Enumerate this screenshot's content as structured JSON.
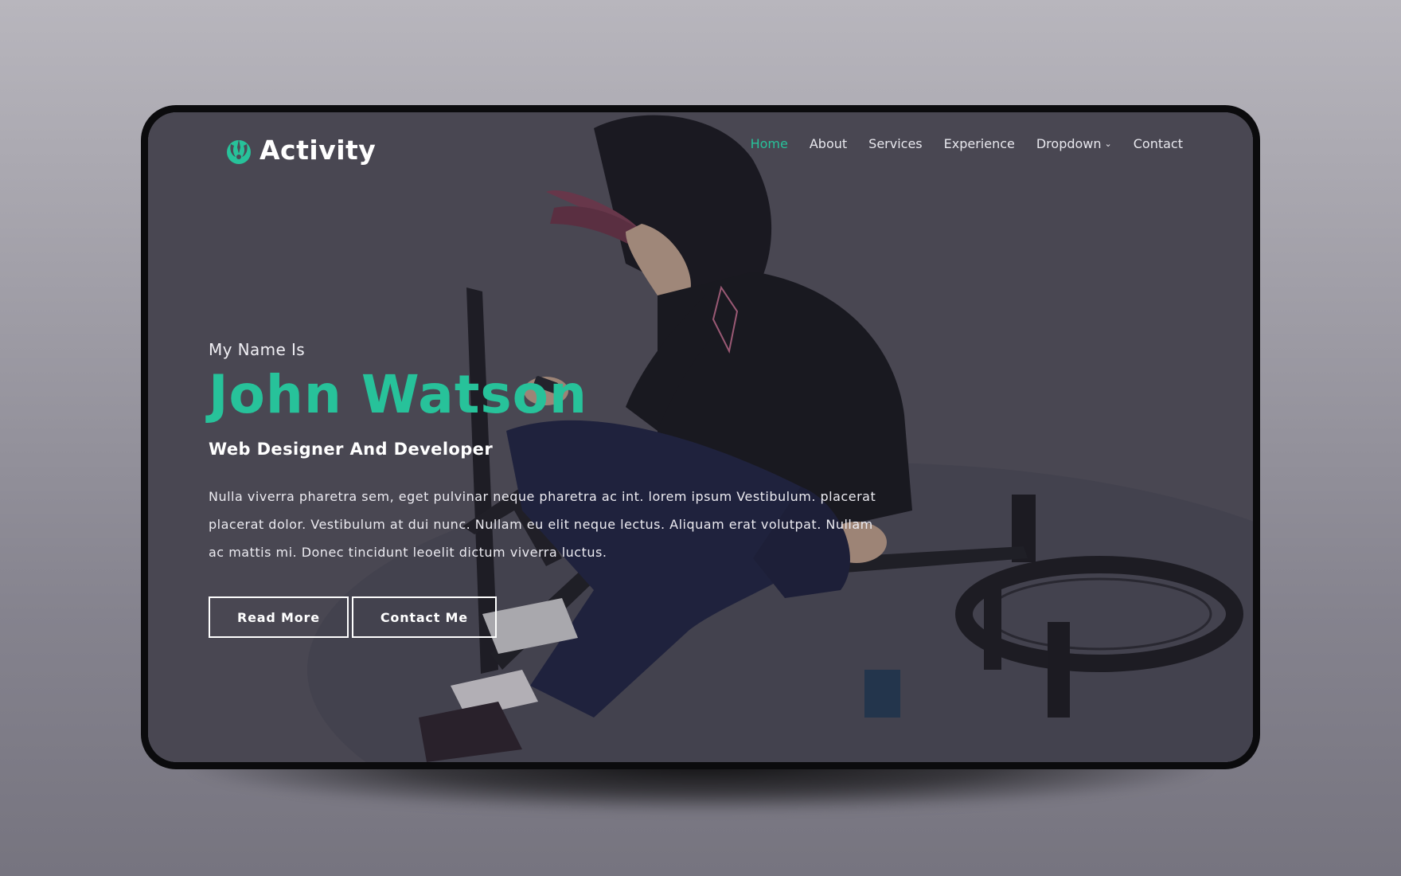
{
  "brand": {
    "name": "Activity",
    "icon": "rebel-emblem-icon",
    "accent_color": "#27c29a"
  },
  "nav": {
    "items": [
      {
        "label": "Home",
        "active": true
      },
      {
        "label": "About",
        "active": false
      },
      {
        "label": "Services",
        "active": false
      },
      {
        "label": "Experience",
        "active": false
      },
      {
        "label": "Dropdown",
        "active": false,
        "has_submenu": true
      },
      {
        "label": "Contact",
        "active": false
      }
    ],
    "chevron_icon": "chevron-down-icon"
  },
  "hero": {
    "intro": "My Name Is",
    "name": "John Watson",
    "role": "Web Designer And Developer",
    "description": "Nulla viverra pharetra sem, eget pulvinar neque pharetra ac int. lorem ipsum Vestibulum. placerat placerat dolor. Vestibulum at dui nunc. Nullam eu elit neque lectus. Aliquam erat volutpat. Nullam ac mattis mi. Donec tincidunt leoelit dictum viverra luctus.",
    "buttons": {
      "read_more": "Read More",
      "contact_me": "Contact Me"
    },
    "name_color": "#27c29a"
  }
}
